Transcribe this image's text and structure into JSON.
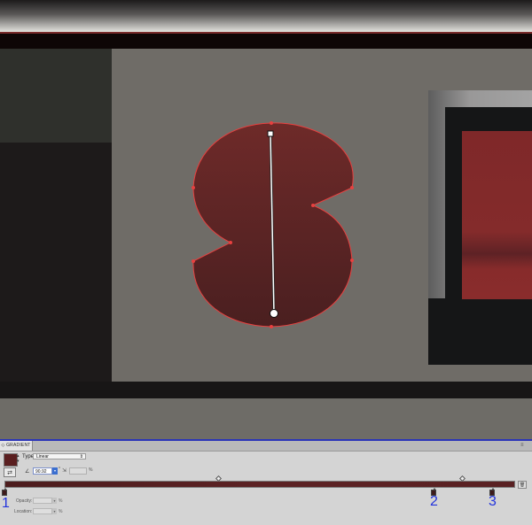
{
  "panel": {
    "tab_label": "◇ GRADIENT",
    "menu_icon": "panel-menu-icon",
    "type_label": "Type",
    "type_value": "Linear",
    "angle_value": "90.92",
    "angle_unit": "°",
    "aspect_unit": "%",
    "opacity_label": "Opacity:",
    "opacity_unit": "%",
    "location_label": "Location:",
    "location_unit": "%",
    "swatch_color": "#5a1f20"
  },
  "annotations": [
    "1",
    "2",
    "3"
  ],
  "colors": {
    "shape_fill_top": "#6e2a29",
    "shape_fill_bottom": "#4a1f20",
    "selection_outline": "#e8403f",
    "accent_blue": "#2233dd"
  },
  "icons": [
    "reverse-gradient-icon",
    "angle-icon",
    "aspect-ratio-icon",
    "delete-stop-icon",
    "gradient-annotator-icon"
  ]
}
